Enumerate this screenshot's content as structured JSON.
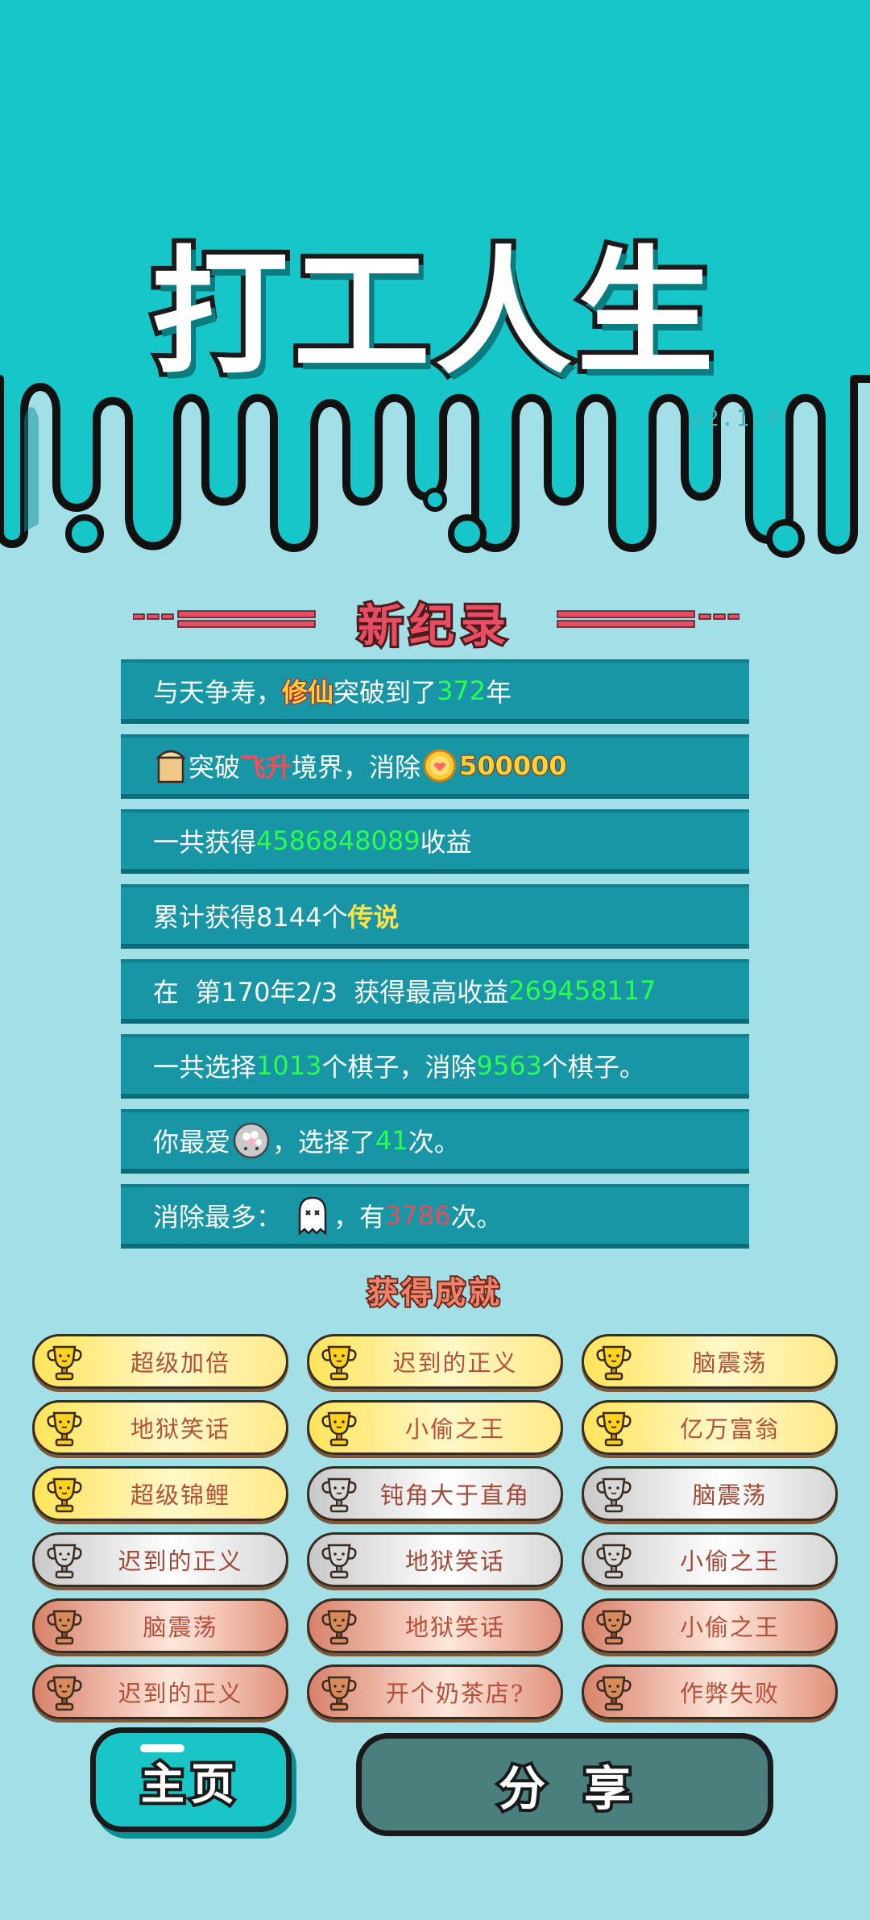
{
  "header": {
    "title": "打工人生",
    "version": "v2.1.0",
    "bg_color": "#16c6c9"
  },
  "record": {
    "heading": "新纪录",
    "rows": [
      {
        "parts": [
          "与天争寿，",
          "修仙",
          "突破到了",
          "372",
          "年"
        ]
      },
      {
        "icon": "bucket-icon",
        "parts": [
          "突破",
          "飞升",
          "境界，消除",
          "500000"
        ],
        "coin_icon": "coin-icon"
      },
      {
        "parts": [
          "一共获得",
          "4586848089",
          "收益"
        ]
      },
      {
        "parts": [
          "累计获得8144个",
          "传说"
        ]
      },
      {
        "parts": [
          "在  第170年2/3  获得最高收益",
          "269458117"
        ]
      },
      {
        "parts": [
          "一共选择",
          "1013",
          "个棋子，消除",
          "9563",
          "个棋子。"
        ]
      },
      {
        "parts": [
          "你最爱",
          "，选择了",
          "41",
          "次。"
        ],
        "icon": "rice-bowl-icon"
      },
      {
        "parts": [
          "消除最多：",
          "，有",
          "3786",
          "次。"
        ],
        "icon": "ghost-icon"
      }
    ]
  },
  "achievements": {
    "heading": "获得成就",
    "items": [
      {
        "label": "超级加倍",
        "tier": "gold"
      },
      {
        "label": "迟到的正义",
        "tier": "gold"
      },
      {
        "label": "脑震荡",
        "tier": "gold"
      },
      {
        "label": "地狱笑话",
        "tier": "gold"
      },
      {
        "label": "小偷之王",
        "tier": "gold"
      },
      {
        "label": "亿万富翁",
        "tier": "gold"
      },
      {
        "label": "超级锦鲤",
        "tier": "gold"
      },
      {
        "label": "钝角大于直角",
        "tier": "silver"
      },
      {
        "label": "脑震荡",
        "tier": "silver"
      },
      {
        "label": "迟到的正义",
        "tier": "silver"
      },
      {
        "label": "地狱笑话",
        "tier": "silver"
      },
      {
        "label": "小偷之王",
        "tier": "silver"
      },
      {
        "label": "脑震荡",
        "tier": "bronze"
      },
      {
        "label": "地狱笑话",
        "tier": "bronze"
      },
      {
        "label": "小偷之王",
        "tier": "bronze"
      },
      {
        "label": "迟到的正义",
        "tier": "bronze"
      },
      {
        "label": "开个奶茶店?",
        "tier": "bronze"
      },
      {
        "label": "作弊失败",
        "tier": "bronze"
      }
    ]
  },
  "buttons": {
    "home": "主页",
    "share": "分享"
  }
}
